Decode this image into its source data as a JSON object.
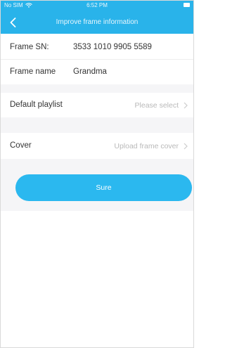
{
  "statusbar": {
    "carrier": "No SIM",
    "time": "6:52 PM"
  },
  "header": {
    "title": "Improve frame information"
  },
  "form": {
    "frame_sn": {
      "label": "Frame SN:",
      "value": "3533 1010 9905 5589"
    },
    "frame_name": {
      "label": "Frame name",
      "value": "Grandma"
    },
    "default_playlist": {
      "label": "Default playlist",
      "placeholder": "Please select"
    },
    "cover": {
      "label": "Cover",
      "placeholder": "Upload frame cover"
    }
  },
  "actions": {
    "sure_label": "Sure"
  },
  "colors": {
    "accent": "#29b3ea",
    "button": "#2bb8ef",
    "placeholder": "#b9b9b9",
    "section_gap": "#f5f5f7"
  },
  "icons": {
    "back": "chevron-left-icon",
    "wifi": "wifi-icon",
    "battery": "battery-icon",
    "row_chevron": "chevron-right-icon"
  }
}
